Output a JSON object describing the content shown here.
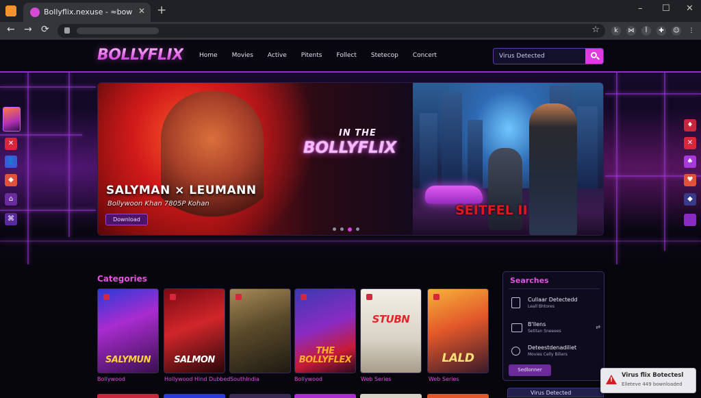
{
  "browser": {
    "tab_title": "Bollyflix.nexuse - ≈bownloaded",
    "tab_close": "✕",
    "new_tab": "+",
    "window_controls": [
      "–",
      "☐",
      "✕"
    ],
    "nav_buttons": [
      "←",
      "→",
      "⟳"
    ],
    "bookmark_star": "☆",
    "extensions": [
      "k",
      "⋈",
      "ꟾ",
      "✚",
      "☺",
      "⋮"
    ]
  },
  "site": {
    "logo": "BOLLYFLIX",
    "nav": [
      "Home",
      "Movies",
      "Active",
      "Pitents",
      "Follect",
      "Stetecop",
      "Concert"
    ],
    "search_placeholder": "Virus Detected",
    "accent": "#e13ae1"
  },
  "hero": {
    "kicker": "IN THE",
    "brand": "BOLLYFLIX",
    "title": "SALYMAN × LEUMANN",
    "subtitle": "Bollywoon Khan   7805P Kohan",
    "download_label": "Download",
    "poster_text": "SEITFEL II",
    "slides": 4,
    "active_slide": 2
  },
  "left_rail": [
    "✕",
    "👤",
    "◆",
    "⌂",
    "⌘"
  ],
  "right_rail": [
    "♦",
    "✕",
    "♠",
    "♥",
    "◆"
  ],
  "categories": {
    "heading": "Categories",
    "items": [
      {
        "label": "Bollywood",
        "art": "SALYMUN",
        "art_color": "#ffd23a"
      },
      {
        "label": "Hollywood Hind Dubbed",
        "art": "SALMON",
        "art_color": "#ffffff"
      },
      {
        "label": "SouthIndia",
        "art": "",
        "art_color": "#ffffff"
      },
      {
        "label": "Bollywood",
        "art": "THE BOLLYFLEX",
        "art_color": "#ffb02b"
      },
      {
        "label": "Web Series",
        "art": "STUBN",
        "art_color": "#e0262a"
      },
      {
        "label": "Web Series",
        "art": "LALD",
        "art_color": "#ffe07a"
      }
    ]
  },
  "searches": {
    "title": "Searches",
    "items": [
      {
        "title": "Cullaar Detectedd",
        "sub": "Leall Bhtores"
      },
      {
        "title": "B'llens",
        "sub": "Setitan Sneeees"
      },
      {
        "title": "Deteestdenadiliet",
        "sub": "Movies Celly Biliers"
      }
    ],
    "button_label": "Sedlonner",
    "bottom_label": "Virus Detected"
  },
  "toast": {
    "title": "Virus flix Botectesl",
    "sub": "Elleteve 449 bownloaded",
    "icon": "!"
  }
}
